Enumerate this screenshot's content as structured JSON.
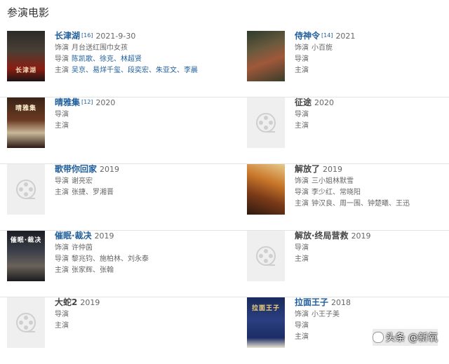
{
  "section_title": "参演电影",
  "labels": {
    "role": "饰演",
    "director": "导演",
    "star": "主演"
  },
  "films": [
    {
      "title": "长津湖",
      "ref": "[16]",
      "year": "2021-9-30",
      "role": "月台送红围巾女孩",
      "director": "陈凯歌、徐克、林超贤",
      "stars": "吴京、易烊千玺、段奕宏、朱亚文、李晨",
      "linked": true
    },
    {
      "title": "侍神令",
      "ref": "[14]",
      "year": "2021",
      "role": "小百旎",
      "director": "",
      "stars": "",
      "linked": true
    },
    {
      "title": "晴雅集",
      "ref": "[12]",
      "year": "2020",
      "role": "",
      "director": "",
      "stars": "",
      "linked": true
    },
    {
      "title": "征途",
      "ref": "",
      "year": "2020",
      "role": "",
      "director": "",
      "stars": "",
      "linked": false
    },
    {
      "title": "歌带你回家",
      "ref": "",
      "year": "2019",
      "role": "",
      "director": "谢亮宏",
      "stars": "张捷、罗湘晋",
      "linked": true
    },
    {
      "title": "解放了",
      "ref": "",
      "year": "2019",
      "role": "三小姐林默雪",
      "director": "李少红、常晓阳",
      "stars": "钟汉良、周一围、钟楚曦、王迅",
      "linked": false
    },
    {
      "title": "催眠·裁决",
      "ref": "",
      "year": "2019",
      "role": "许仲茵",
      "director": "黎兆钧、施柏林、刘永泰",
      "stars": "张家辉、张翰",
      "linked": true
    },
    {
      "title": "解放·终局营救",
      "ref": "",
      "year": "2019",
      "role": "",
      "director": "",
      "stars": "",
      "linked": false
    },
    {
      "title": "大蛇2",
      "ref": "",
      "year": "2019",
      "role": "",
      "director": "",
      "stars": "",
      "linked": false
    },
    {
      "title": "拉面王子",
      "ref": "",
      "year": "2018",
      "role": "小王子美",
      "director": "",
      "stars": "",
      "linked": true
    }
  ],
  "posters": {
    "p1": "长津湖",
    "p3": "晴雅集",
    "p7": "催眠·裁决",
    "p10": "拉面王子"
  },
  "watermark": "头条 @新氧",
  "colors": {
    "link": "#1e5d9c",
    "text": "#666666",
    "divider": "#e4e4e4",
    "placeholder": "#efefef"
  }
}
